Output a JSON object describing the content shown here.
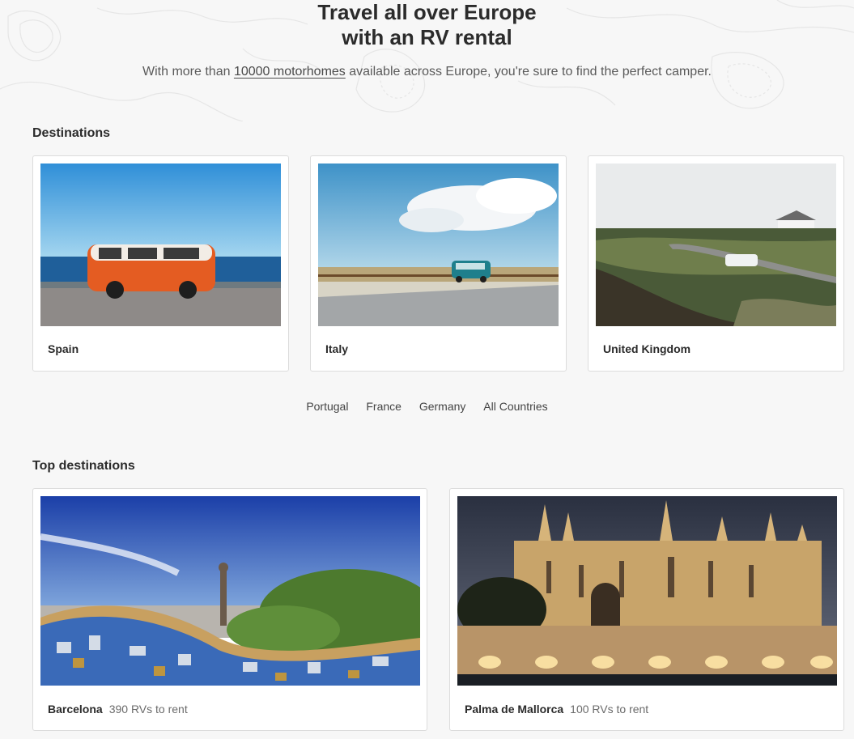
{
  "hero": {
    "title_line1": "Travel all over Europe",
    "title_line2": "with an RV rental",
    "subtitle_before": "With more than ",
    "subtitle_link": "10000 motorhomes",
    "subtitle_after": " available across Europe, you're sure to find the perfect camper."
  },
  "destinations": {
    "heading": "Destinations",
    "cards": [
      {
        "label": "Spain",
        "image": "orange-vw-van-by-sea"
      },
      {
        "label": "Italy",
        "image": "blue-van-on-coastal-road"
      },
      {
        "label": "United Kingdom",
        "image": "white-van-on-moorland-road"
      }
    ],
    "more_links": [
      "Portugal",
      "France",
      "Germany",
      "All Countries"
    ]
  },
  "top_destinations": {
    "heading": "Top destinations",
    "cards": [
      {
        "label": "Barcelona",
        "count": "390 RVs to rent",
        "image": "park-guell-mosaic-bench"
      },
      {
        "label": "Palma de Mallorca",
        "count": "100 RVs to rent",
        "image": "palma-cathedral-at-night"
      }
    ]
  },
  "colors": {
    "background": "#f7f7f7",
    "text": "#2b2b2b",
    "card_border": "#dcdcdc"
  }
}
